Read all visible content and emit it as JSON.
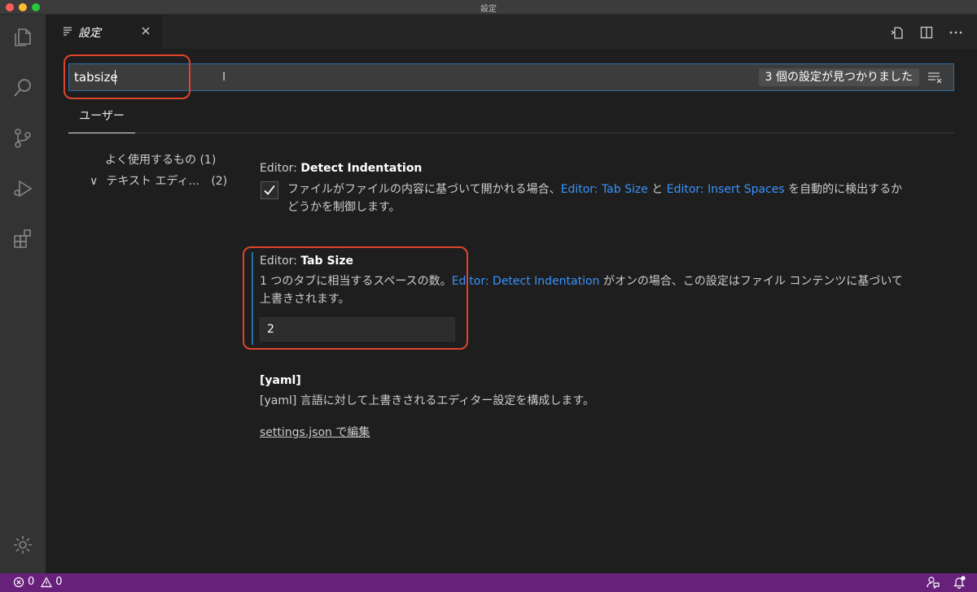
{
  "window": {
    "title": "設定"
  },
  "editor_tab": {
    "label": "設定"
  },
  "search": {
    "value": "tabsize",
    "result_count": "3 個の設定が見つかりました"
  },
  "scope": {
    "user_tab": "ユーザー"
  },
  "toc": [
    {
      "label": "よく使用するもの (1)"
    },
    {
      "label": "テキスト エディ...",
      "count": "(2)"
    }
  ],
  "settings": {
    "detect_indentation": {
      "category": "Editor: ",
      "name": "Detect Indentation",
      "checked": true,
      "desc_part1": "ファイルがファイルの内容に基づいて開かれる場合、",
      "link1": "Editor: Tab Size",
      "desc_part2": " と ",
      "link2": "Editor: Insert Spaces",
      "desc_part3": " を自動的に検出するか",
      "desc_line2": "どうかを制御します。"
    },
    "tab_size": {
      "category": "Editor: ",
      "name": "Tab Size",
      "desc_part1": "1 つのタブに相当するスペースの数。",
      "link": "Editor: Detect Indentation",
      "desc_part2": " がオンの場合、この設定はファイル コンテンツに基づいて",
      "desc_line2": "上書きされます。",
      "value": "2"
    },
    "yaml": {
      "name": "[yaml]",
      "desc": "[yaml] 言語に対して上書きされるエディター設定を構成します。",
      "edit_link": "settings.json で編集"
    }
  },
  "statusbar": {
    "errors": "0",
    "warnings": "0"
  },
  "colors": {
    "accent": "#3794ff",
    "statusbar": "#68217a",
    "highlight": "#e0442d"
  }
}
